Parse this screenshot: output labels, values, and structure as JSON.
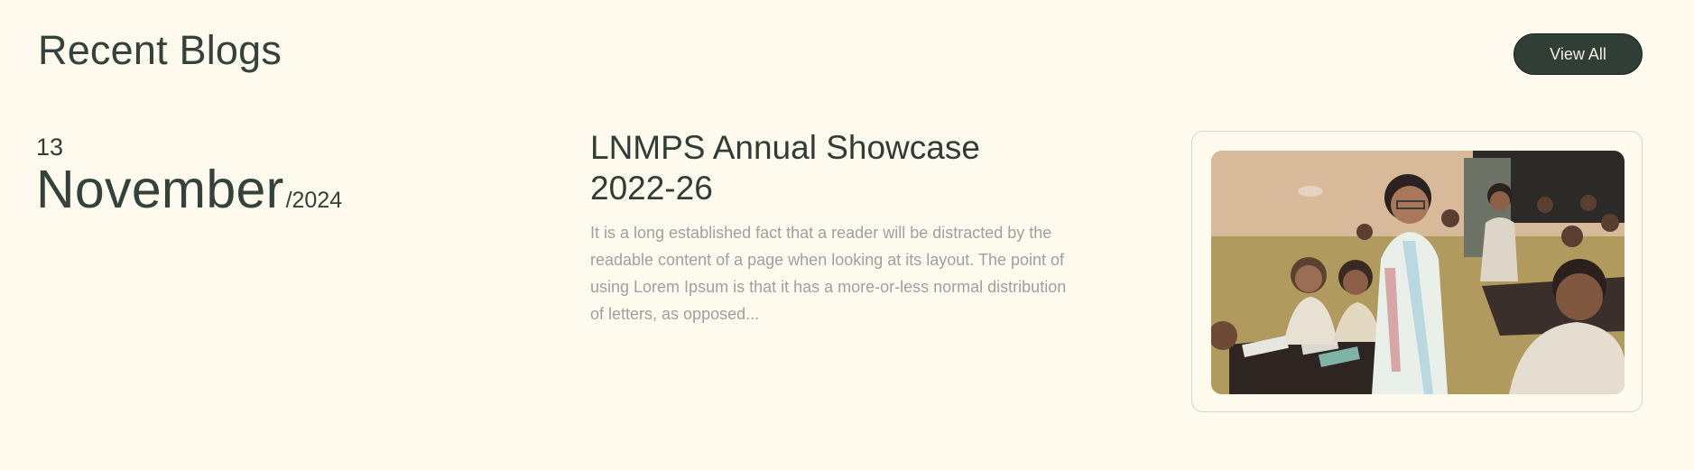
{
  "section": {
    "title": "Recent Blogs",
    "view_all_label": "View All"
  },
  "post": {
    "date": {
      "day": "13",
      "month": "November",
      "year": "/2024"
    },
    "title": "LNMPS Annual Showcase 2022-26",
    "excerpt": "It is a long established fact that a reader will be distracted by the readable content of a page when looking at its layout. The point of using Lorem Ipsum is that it has a more-or-less normal distribution of letters, as opposed...",
    "image": {
      "icon": "classroom-photo"
    }
  },
  "colors": {
    "page_background": "#fefaee",
    "heading_text": "#33423b",
    "button_background": "#313e36",
    "button_text": "#f3efe2",
    "excerpt_text": "#9ea0a2",
    "card_border": "#d9d4c6"
  }
}
